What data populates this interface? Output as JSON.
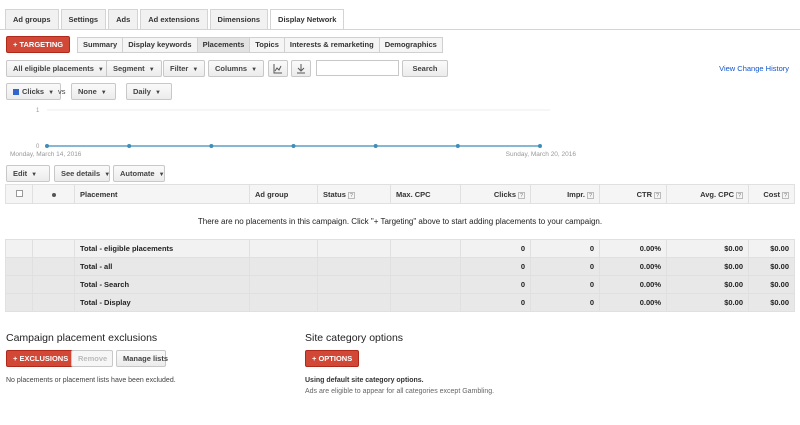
{
  "tabs": [
    "Ad groups",
    "Settings",
    "Ads",
    "Ad extensions",
    "Dimensions",
    "Display Network"
  ],
  "targeting_button": "TARGETING",
  "subtabs": [
    "Summary",
    "Display keywords",
    "Placements",
    "Topics",
    "Interests & remarketing",
    "Demographics"
  ],
  "filters": {
    "eligible": "All eligible placements",
    "segment": "Segment",
    "filter": "Filter",
    "columns": "Columns",
    "search_button": "Search",
    "search_value": ""
  },
  "view_change_history": "View Change History",
  "metric": {
    "first": "Clicks",
    "vs": "vs",
    "second": "None",
    "period": "Daily"
  },
  "chart_data": {
    "type": "line",
    "x": [
      "Monday, March 14, 2016",
      "",
      "",
      "",
      "",
      "",
      "Sunday, March 20, 2016"
    ],
    "series": [
      {
        "values": [
          0,
          0,
          0,
          0,
          0,
          0,
          0
        ]
      }
    ],
    "ylim": [
      0,
      1
    ],
    "yticks": [
      "1",
      "0"
    ],
    "x_labels": [
      "Monday, March 14, 2016",
      "Sunday, March 20, 2016"
    ],
    "color": "#3d8eb9"
  },
  "actions": {
    "edit": "Edit",
    "see_details": "See details",
    "automate": "Automate"
  },
  "table": {
    "headers": [
      "Placement",
      "Ad group",
      "Status",
      "Max. CPC",
      "Clicks",
      "Impr.",
      "CTR",
      "Avg. CPC",
      "Cost"
    ],
    "empty_message": "There are no placements in this campaign. Click \"+ Targeting\" above to start adding placements to your campaign.",
    "totals": [
      {
        "label": "Total - eligible placements",
        "clicks": "0",
        "impr": "0",
        "ctr": "0.00%",
        "avg_cpc": "$0.00",
        "cost": "$0.00"
      },
      {
        "label": "Total - all",
        "clicks": "0",
        "impr": "0",
        "ctr": "0.00%",
        "avg_cpc": "$0.00",
        "cost": "$0.00"
      },
      {
        "label": "Total - Search",
        "clicks": "0",
        "impr": "0",
        "ctr": "0.00%",
        "avg_cpc": "$0.00",
        "cost": "$0.00"
      },
      {
        "label": "Total - Display",
        "clicks": "0",
        "impr": "0",
        "ctr": "0.00%",
        "avg_cpc": "$0.00",
        "cost": "$0.00"
      }
    ]
  },
  "exclusions": {
    "title": "Campaign placement exclusions",
    "button": "EXCLUSIONS",
    "remove": "Remove",
    "manage": "Manage lists",
    "note": "No placements or placement lists have been excluded."
  },
  "site_category": {
    "title": "Site category options",
    "button": "OPTIONS",
    "note_bold": "Using default site category options.",
    "note": "Ads are eligible to appear for all categories except Gambling."
  },
  "colors": {
    "accent_red": "#d14836",
    "link_blue": "#1155cc",
    "line": "#3d8eb9"
  }
}
